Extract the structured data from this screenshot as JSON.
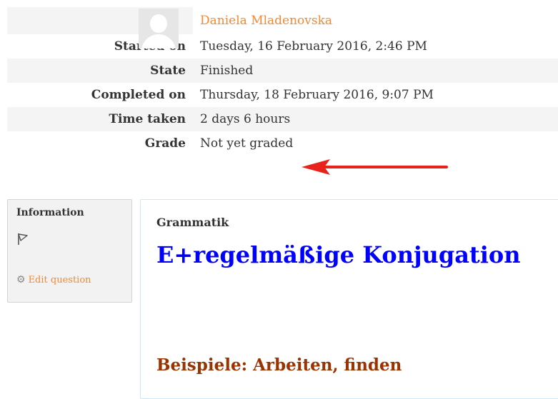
{
  "summary": {
    "user_name": "Daniela Mladenovska",
    "rows": [
      {
        "label": "Started on",
        "value": "Tuesday, 16 February 2016, 2:46 PM"
      },
      {
        "label": "State",
        "value": "Finished"
      },
      {
        "label": "Completed on",
        "value": "Thursday, 18 February 2016, 9:07 PM"
      },
      {
        "label": "Time taken",
        "value": "2 days 6 hours"
      },
      {
        "label": "Grade",
        "value": "Not yet graded"
      }
    ]
  },
  "info": {
    "title": "Information",
    "edit_label": "Edit question",
    "flag_icon": "flag-icon",
    "gear_icon": "gear-icon"
  },
  "question": {
    "category": "Grammatik",
    "heading": "E+regelmäßige Konjugation",
    "subheading": "Beispiele: Arbeiten, finden"
  },
  "colors": {
    "link": "#f7882f",
    "heading": "#0000ff",
    "subheading": "#993300",
    "arrow": "#e8211b"
  }
}
